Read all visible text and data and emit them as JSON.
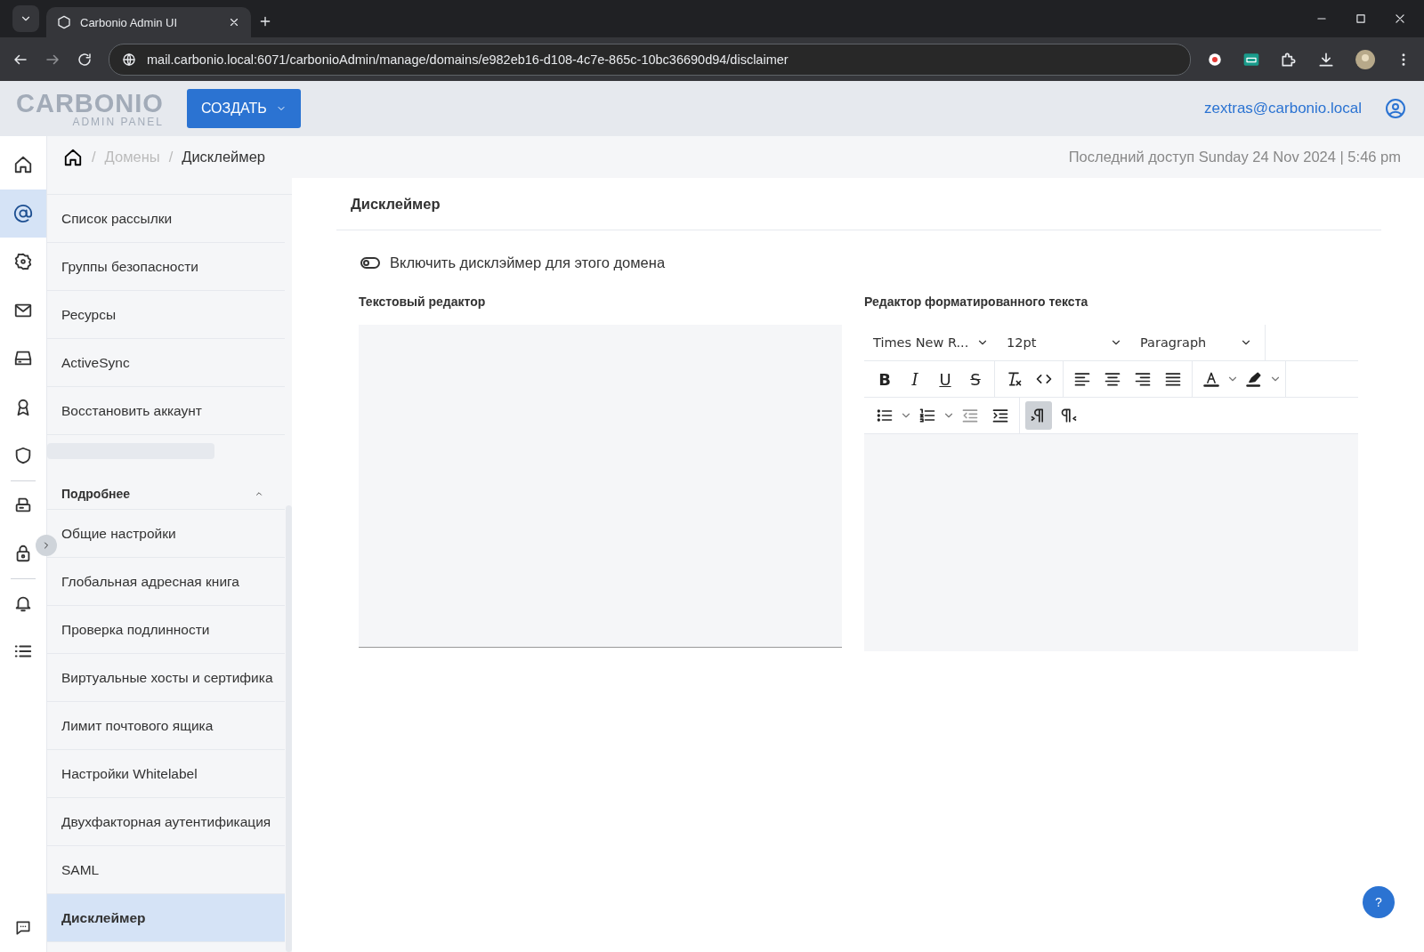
{
  "browser": {
    "tab_title": "Carbonio Admin UI",
    "url": "mail.carbonio.local:6071/carbonioAdmin/manage/domains/e982eb16-d108-4c7e-865c-10bc36690d94/disclaimer"
  },
  "header": {
    "logo": "CARBONIO",
    "logo_sub": "ADMIN PANEL",
    "create_button": "СОЗДАТЬ",
    "user": "zextras@carbonio.local"
  },
  "rail": {
    "items": [
      {
        "kind": "home",
        "selected": false
      },
      {
        "kind": "at",
        "selected": true
      },
      {
        "kind": "badge",
        "selected": false
      },
      {
        "kind": "mail",
        "selected": false
      },
      {
        "kind": "drive",
        "selected": false
      },
      {
        "kind": "award",
        "selected": false
      },
      {
        "kind": "shield",
        "selected": false
      },
      {
        "kind": "divider"
      },
      {
        "kind": "printer",
        "selected": false
      },
      {
        "kind": "lock",
        "selected": false
      },
      {
        "kind": "divider"
      },
      {
        "kind": "bell",
        "selected": false
      },
      {
        "kind": "list",
        "selected": false
      }
    ]
  },
  "breadcrumb": {
    "items": [
      {
        "separator": "/",
        "label": "Домены"
      },
      {
        "separator": "/",
        "label": "Дисклеймер"
      }
    ],
    "last_access": "Последний доступ Sunday 24 Nov 2024 | 5:46 pm"
  },
  "sidebar": {
    "items": [
      {
        "label": "Список рассылки",
        "selected": false
      },
      {
        "label": "Группы безопасности",
        "selected": false
      },
      {
        "label": "Ресурсы",
        "selected": false
      },
      {
        "label": "ActiveSync",
        "selected": false
      },
      {
        "label": "Восстановить аккаунт",
        "selected": false
      }
    ],
    "section": {
      "title": "Подробнее",
      "expanded": true,
      "items": [
        {
          "label": "Общие настройки",
          "selected": false
        },
        {
          "label": "Глобальная адресная книга",
          "selected": false
        },
        {
          "label": "Проверка подлинности",
          "selected": false
        },
        {
          "label": "Виртуальные хосты и сертифика",
          "selected": false
        },
        {
          "label": "Лимит почтового ящика",
          "selected": false
        },
        {
          "label": "Настройки Whitelabel",
          "selected": false
        },
        {
          "label": "Двухфакторная аутентификация",
          "selected": false
        },
        {
          "label": "SAML",
          "selected": false
        },
        {
          "label": "Дисклеймер",
          "selected": true
        }
      ]
    }
  },
  "main": {
    "title": "Дисклеймер",
    "help_button": "?",
    "toggle": {
      "label": "Включить дисклэймер для этого домена",
      "on": false
    },
    "plain_editor": {
      "label": "Текстовый редактор"
    },
    "rich_editor": {
      "label": "Редактор форматированного текста",
      "font": "Times New R...",
      "size": "12pt",
      "block": "Paragraph",
      "toolbar_rows": [
        [
          {
            "kind": "bold",
            "label": "B",
            "selected": false
          },
          {
            "kind": "italic",
            "label": "I",
            "selected": false
          },
          {
            "kind": "underline",
            "label": "U",
            "selected": false
          },
          {
            "kind": "strike",
            "label": "S",
            "selected": false
          },
          {
            "kind": "sep"
          },
          {
            "kind": "clear",
            "selected": false
          },
          {
            "kind": "code",
            "selected": false
          },
          {
            "kind": "sep"
          },
          {
            "kind": "align-left",
            "selected": false
          },
          {
            "kind": "align-center",
            "selected": false
          },
          {
            "kind": "align-right",
            "selected": false
          },
          {
            "kind": "justify",
            "selected": false
          },
          {
            "kind": "sep"
          },
          {
            "kind": "text-color",
            "selected": false
          },
          {
            "kind": "highlight",
            "selected": false
          },
          {
            "kind": "sep"
          }
        ],
        [
          {
            "kind": "bullets",
            "selected": false
          },
          {
            "kind": "numbers",
            "selected": false
          },
          {
            "kind": "outdent",
            "selected": false
          },
          {
            "kind": "indent",
            "selected": false
          },
          {
            "kind": "sep"
          },
          {
            "kind": "ltr",
            "selected": true
          },
          {
            "kind": "rtl",
            "selected": false
          }
        ]
      ]
    }
  }
}
